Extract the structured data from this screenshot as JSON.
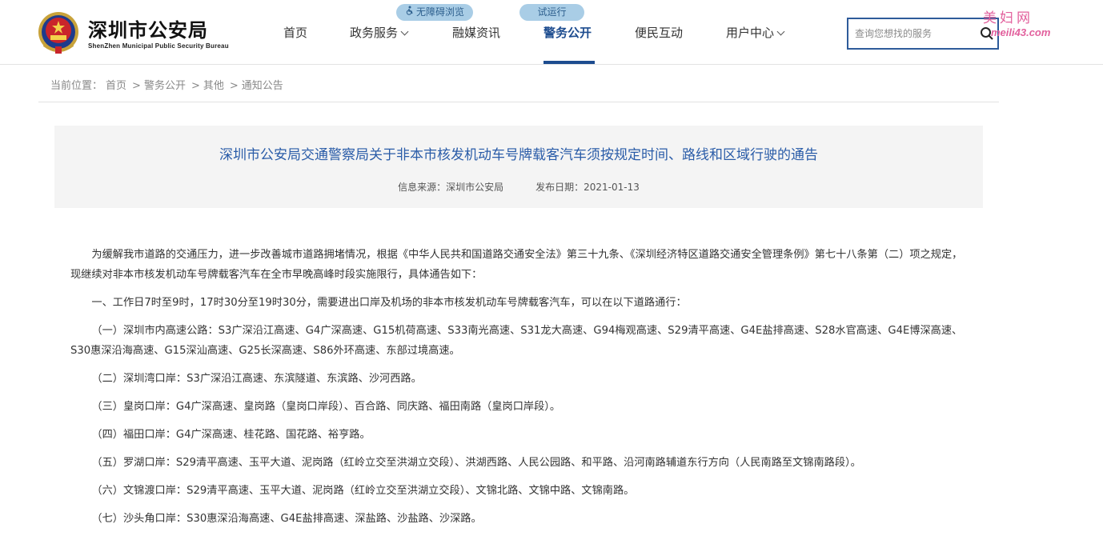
{
  "header": {
    "logo_title": "深圳市公安局",
    "logo_subtitle": "ShenZhen Municipal Public Security Bureau",
    "nav": [
      {
        "label": "首页"
      },
      {
        "label": "政务服务"
      },
      {
        "label": "融媒资讯"
      },
      {
        "label": "警务公开"
      },
      {
        "label": "便民互动"
      },
      {
        "label": "用户中心"
      }
    ],
    "accessibility_label": "无障碍浏览",
    "trial_label": "试运行",
    "search_placeholder": "查询您想找的服务",
    "watermark_text": "美妇网",
    "watermark_url": "meili43.com",
    "accent_color": "#1d4c8f"
  },
  "breadcrumb": {
    "prefix": "当前位置：",
    "items": [
      "首页",
      "警务公开",
      "其他",
      "通知公告"
    ]
  },
  "article": {
    "title": "深圳市公安局交通警察局关于非本市核发机动车号牌载客汽车须按规定时间、路线和区域行驶的通告",
    "source": "信息来源：深圳市公安局",
    "date": "发布日期：2021-01-13",
    "paragraphs": [
      "为缓解我市道路的交通压力，进一步改善城市道路拥堵情况，根据《中华人民共和国道路交通安全法》第三十九条、《深圳经济特区道路交通安全管理条例》第七十八条第（二）项之规定，现继续对非本市核发机动车号牌载客汽车在全市早晚高峰时段实施限行，具体通告如下：",
      "一、工作日7时至9时，17时30分至19时30分，需要进出口岸及机场的非本市核发机动车号牌载客汽车，可以在以下道路通行：",
      "（一）深圳市内高速公路：S3广深沿江高速、G4广深高速、G15机荷高速、S33南光高速、S31龙大高速、G94梅观高速、S29清平高速、G4E盐排高速、S28水官高速、G4E博深高速、S30惠深沿海高速、G15深汕高速、G25长深高速、S86外环高速、东部过境高速。",
      "（二）深圳湾口岸：S3广深沿江高速、东滨隧道、东滨路、沙河西路。",
      "（三）皇岗口岸：G4广深高速、皇岗路（皇岗口岸段）、百合路、同庆路、福田南路（皇岗口岸段）。",
      "（四）福田口岸：G4广深高速、桂花路、国花路、裕亨路。",
      "（五）罗湖口岸：S29清平高速、玉平大道、泥岗路（红岭立交至洪湖立交段）、洪湖西路、人民公园路、和平路、沿河南路辅道东行方向（人民南路至文锦南路段）。",
      "（六）文锦渡口岸：S29清平高速、玉平大道、泥岗路（红岭立交至洪湖立交段）、文锦北路、文锦中路、文锦南路。",
      "（七）沙头角口岸：S30惠深沿海高速、G4E盐排高速、深盐路、沙盐路、沙深路。"
    ]
  }
}
